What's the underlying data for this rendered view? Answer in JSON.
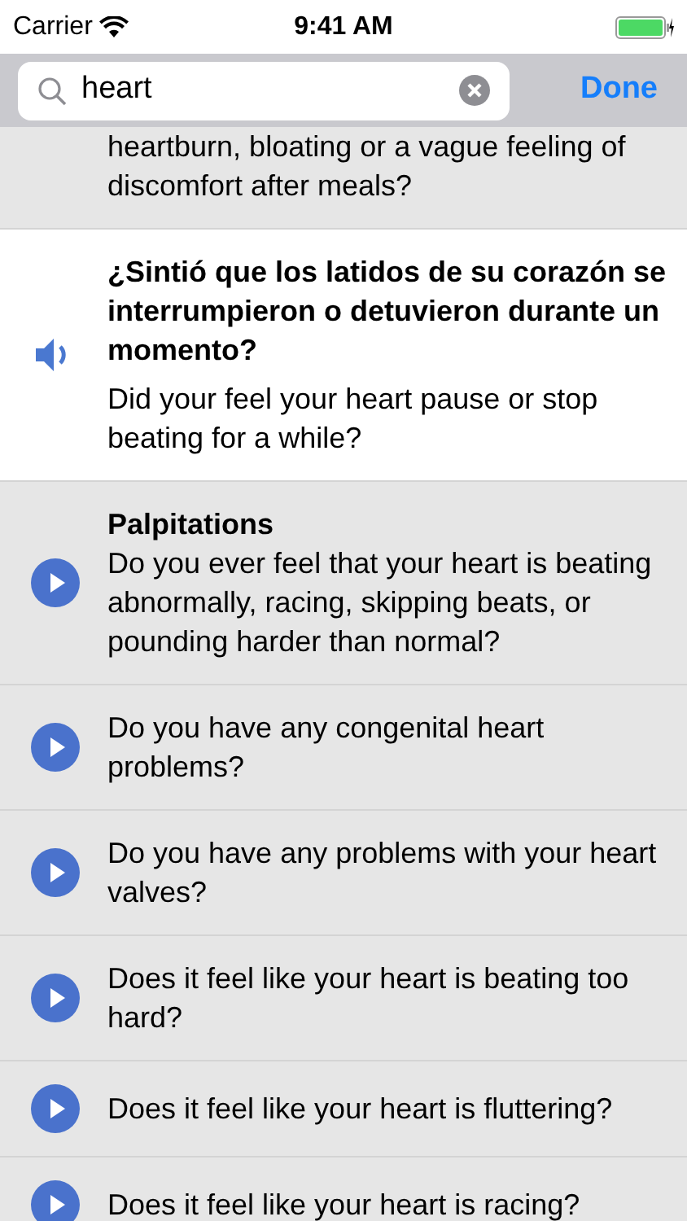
{
  "status_bar": {
    "carrier": "Carrier",
    "time": "9:41 AM"
  },
  "search": {
    "value": "heart",
    "done": "Done"
  },
  "rows": [
    {
      "text": "heartburn, bloating or a vague feeling of discomfort after meals?",
      "selected": false
    },
    {
      "spanish": "¿Sintió que los latidos de su corazón se interrumpieron o detuvieron durante un momento?",
      "text": "Did your feel your heart pause or stop beating for a while?",
      "selected": true
    },
    {
      "title": "Palpitations",
      "text": "Do you ever feel that your heart is beating abnormally, racing, skipping beats, or pounding harder than normal?",
      "selected": false
    },
    {
      "text": "Do you have any congenital heart problems?",
      "selected": false
    },
    {
      "text": "Do you have any problems with your heart valves?",
      "selected": false
    },
    {
      "text": "Does it feel like your heart is beating too hard?",
      "selected": false
    },
    {
      "text": "Does it feel like your heart is fluttering?",
      "selected": false
    },
    {
      "text": "Does it feel like your heart is racing?",
      "selected": false
    }
  ]
}
